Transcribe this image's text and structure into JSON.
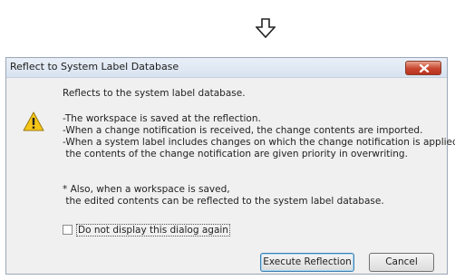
{
  "dialog": {
    "title": "Reflect to System Label Database",
    "message": {
      "line1": "Reflects to the system label database.",
      "line2": "-The workspace is saved at the reflection.\n-When a change notification is received, the change contents are imported.\n-When a system label includes changes on which the change notification is applied,\n the contents of the change notification are given priority in overwriting.",
      "line3": "* Also, when a workspace is saved,\n the edited contents can be reflected to the system label database."
    },
    "checkbox": {
      "label": "Do not display this dialog again",
      "checked": false
    },
    "buttons": {
      "execute": "Execute Reflection",
      "cancel": "Cancel"
    }
  },
  "icons": {
    "flow": "down-arrow-icon",
    "warning": "warning-icon",
    "close": "close-icon"
  },
  "colors": {
    "warning_fill": "#f5c518",
    "close_button": "#c7462e"
  }
}
